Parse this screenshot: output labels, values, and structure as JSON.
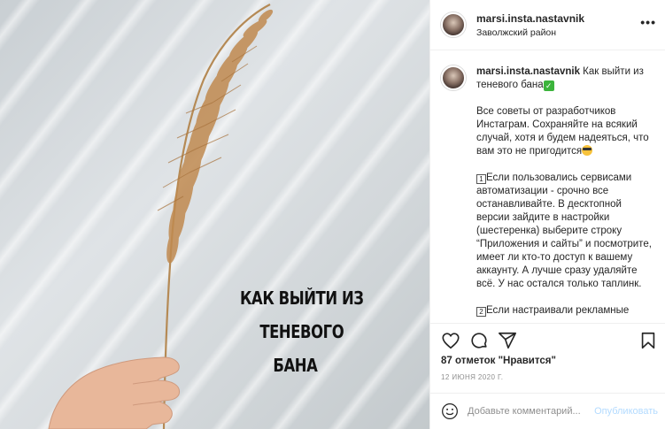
{
  "photo": {
    "caption_line1": "КАК ВЫЙТИ ИЗ ТЕНЕВОГО",
    "caption_line2": "БАНА"
  },
  "header": {
    "username": "marsi.insta.nastavnik",
    "location": "Заволжский район",
    "more_label": "•••"
  },
  "comment": {
    "username": "marsi.insta.nastavnik",
    "title": " Как выйти из теневого бана",
    "p1": "Все советы от разработчиков Инстаграм. Сохраняйте на всякий случай, хотя и будем надеяться, что вам это не пригодится",
    "p2_num": "1",
    "p2": "Если пользовались сервисами автоматизации - срочно все останавливайте. В десктопной версии зайдите в настройки (шестеренка) выберите строку “Приложения и сайты” и посмотрите, имеет ли кто-то доступ к вашему аккаунту. А лучше сразу удаляйте всё. У нас остался только таплинк.",
    "p3_num": "2",
    "p3": "Если настраивали рекламные"
  },
  "likes": "87 отметок \"Нравится\"",
  "date": "12 июня 2020 г.",
  "add_comment": {
    "placeholder": "Добавьте комментарий...",
    "publish_label": "Опубликовать"
  }
}
